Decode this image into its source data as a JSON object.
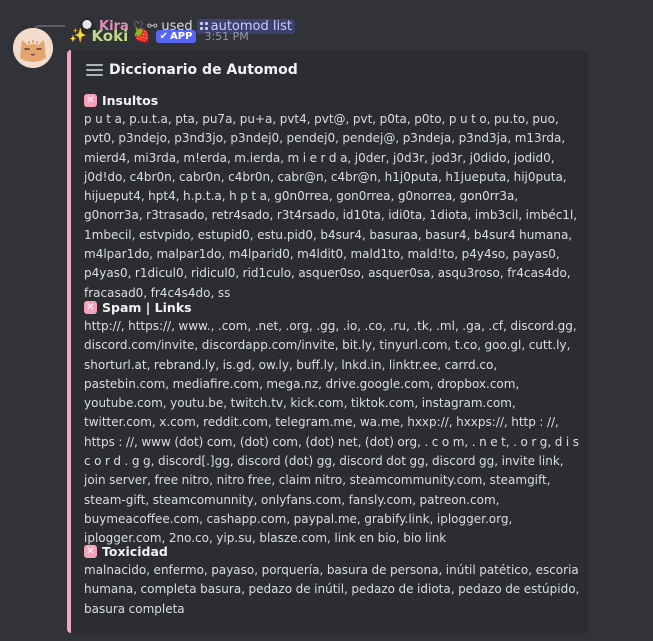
{
  "reply": {
    "user": "Kira",
    "badges": "♡ ⚯",
    "action": "used",
    "command": "automod list"
  },
  "message": {
    "sparkle": "✨",
    "bot_name": "Koki",
    "bot_emoji": "🍓",
    "app_badge": "APP",
    "timestamp": "3:51 PM"
  },
  "embed": {
    "accent_color": "#f1a6c1",
    "title": "Diccionario de Automod",
    "sections": [
      {
        "icon": "✕",
        "heading": "Insultos",
        "body": "p u t a, p.u.t.a, pta, pu7a, pu+a, pvt4, pvt@, pvt, p0ta, p0to, p u t o, pu.to, puo, pvt0, p3ndejo, p3nd3jo, p3ndej0, pendej0, pendej@, p3ndeja, p3nd3ja, m13rda, mierd4, mi3rda, m!erda, m.ierda, m i e r d a, j0der, j0d3r, jod3r, j0dido, jodid0, j0d!do, c4br0n, cabr0n, c4br0n, cabr@n, c4br@n, h1j0puta, h1jueputa, hij0puta, hijueput4, hpt4, h.p.t.a, h p t a, g0n0rrea, gon0rrea, g0norrea, gon0rr3a, g0norr3a, r3trasado, retr4sado, r3t4rsado, id10ta, idi0ta, 1diota, imb3cil, imbéc1l, 1mbecil, estvpido, estupid0, estu.pid0, b4sur4, basuraa, basur4, b4sur4 humana, m4lpar1do, malpar1do, m4lparid0, m4ldit0, mald1to, mald!to, p4y4so, payas0, p4yas0, r1dicul0, ridicul0, rid1culo, asquer0so, asquer0sa, asqu3roso, fr4cas4do, fracasad0, fr4c4s4do, ss"
      },
      {
        "icon": "✕",
        "heading": "Spam | Links",
        "body": "http://, https://, www., .com, .net, .org, .gg, .io, .co, .ru, .tk, .ml, .ga, .cf, discord.gg, discord.com/invite, discordapp.com/invite, bit.ly, tinyurl.com, t.co, goo.gl, cutt.ly, shorturl.at, rebrand.ly, is.gd, ow.ly, buff.ly, lnkd.in, linktr.ee, carrd.co, pastebin.com, mediafire.com, mega.nz, drive.google.com, dropbox.com, youtube.com, youtu.be, twitch.tv, kick.com, tiktok.com, instagram.com, twitter.com, x.com, reddit.com, telegram.me, wa.me, hxxp://, hxxps://, http : //, https : //, www (dot) com, (dot) com, (dot) net, (dot) org, . c o m, . n e t, . o r g, d i s c o r d . g g, discord[.]gg, discord (dot) gg, discord dot gg, discord gg, invite link, join server, free nitro, nitro free, claim nitro, steamcommunity.com, steamgift, steam-gift, steamcomunnity, onlyfans.com, fansly.com, patreon.com, buymeacoffee.com, cashapp.com, paypal.me, grabify.link, iplogger.org, iplogger.com, 2no.co, yip.su, blasze.com, link en bio, bio link"
      },
      {
        "icon": "✕",
        "heading": "Toxicidad",
        "body": "malnacido, enfermo, payaso, porquería, basura de persona, inútil patético, escoria humana, completa basura, pedazo de inútil, pedazo de idiota, pedazo de estúpido, basura completa"
      }
    ]
  }
}
